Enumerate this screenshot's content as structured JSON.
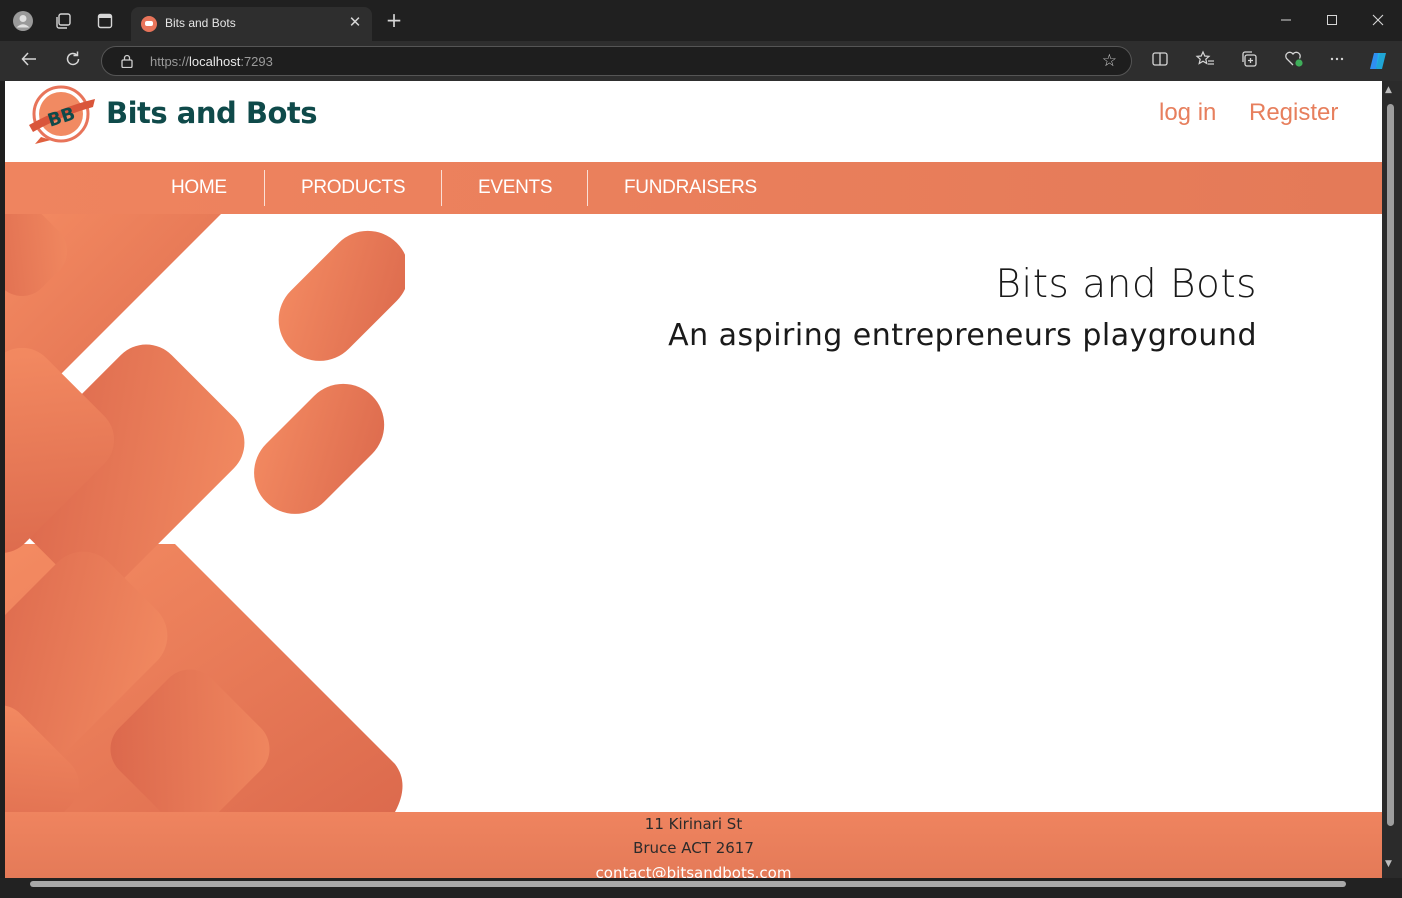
{
  "browser": {
    "tab_title": "Bits and Bots",
    "url_scheme": "https://",
    "url_host": "localhost",
    "url_port": ":7293",
    "tab_close": "✕",
    "new_tab": "+"
  },
  "site": {
    "brand": "Bits and Bots",
    "logo_text": "BB",
    "auth": {
      "login": "log in",
      "register": "Register"
    },
    "nav": [
      "HOME",
      "PRODUCTS",
      "EVENTS",
      "FUNDRAISERS"
    ],
    "hero": {
      "title": "Bits and Bots",
      "subtitle": "An aspiring entrepreneurs playground"
    },
    "footer": {
      "street": "11 Kirinari St",
      "city": "Bruce ACT 2617",
      "email": "contact@bitsandbots.com"
    }
  },
  "colors": {
    "accent": "#e77f5d",
    "brand_text": "#0f4a4a"
  }
}
